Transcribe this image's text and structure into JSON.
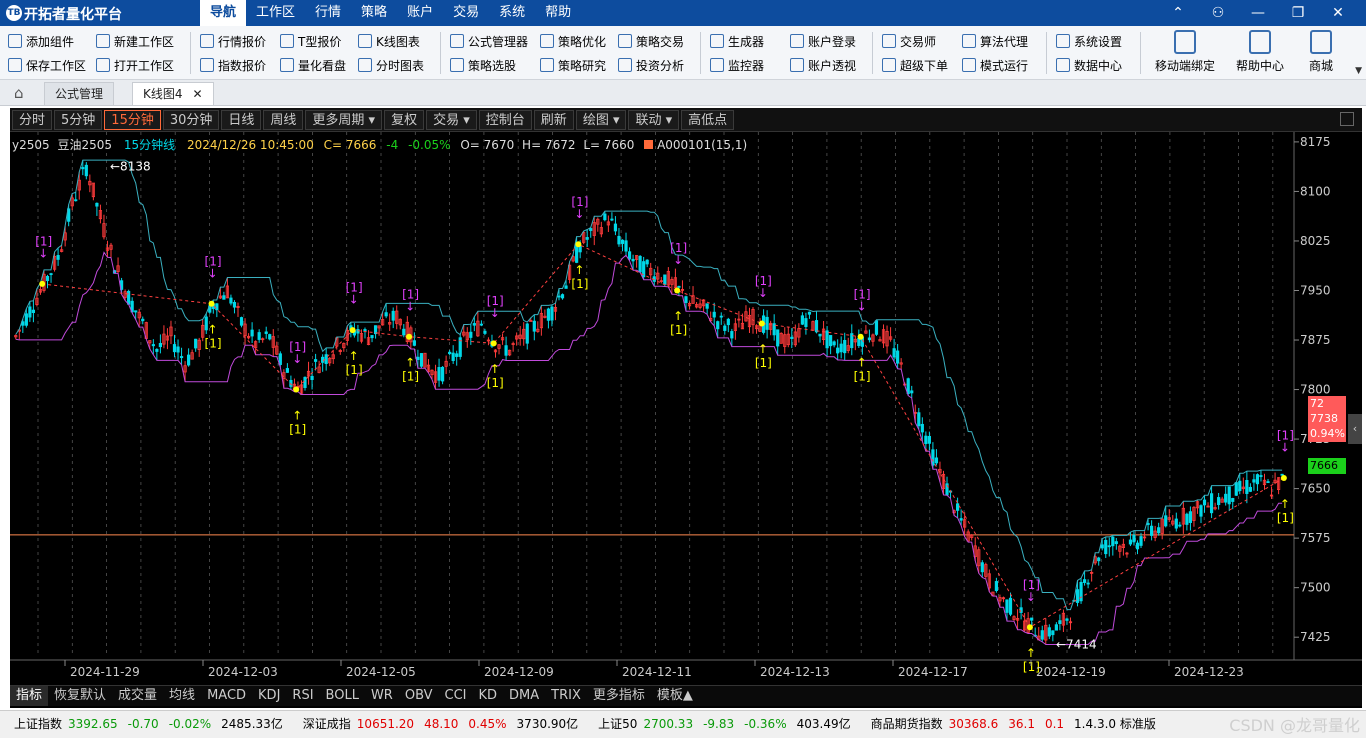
{
  "app": {
    "title": "开拓者量化平台",
    "logo_text": "TB"
  },
  "menu": [
    "导航",
    "工作区",
    "行情",
    "策略",
    "账户",
    "交易",
    "系统",
    "帮助"
  ],
  "menu_active": 0,
  "toolbar": {
    "col1": [
      "添加组件",
      "保存工作区"
    ],
    "col2": [
      "新建工作区",
      "打开工作区"
    ],
    "col3": [
      "行情报价",
      "指数报价"
    ],
    "col4": [
      "T型报价",
      "量化看盘"
    ],
    "col5": [
      "K线图表",
      "分时图表"
    ],
    "col6": [
      "公式管理器",
      "策略选股"
    ],
    "col7": [
      "策略优化",
      "策略研究"
    ],
    "col8": [
      "策略交易",
      "投资分析"
    ],
    "col9": [
      "生成器",
      "监控器"
    ],
    "col10": [
      "账户登录",
      "账户透视"
    ],
    "col11": [
      "交易师",
      "超级下单"
    ],
    "col12": [
      "算法代理",
      "模式运行"
    ],
    "col13": [
      "系统设置",
      "数据中心"
    ],
    "big": [
      "移动端绑定",
      "帮助中心",
      "商城"
    ]
  },
  "tabs": [
    "公式管理",
    "K线图4"
  ],
  "period_buttons": [
    "分时",
    "5分钟",
    "15分钟",
    "30分钟",
    "日线",
    "周线",
    "更多周期 ▾",
    "复权",
    "交易 ▾",
    "控制台",
    "刷新",
    "绘图 ▾",
    "联动 ▾",
    "高低点"
  ],
  "period_active": 2,
  "info": {
    "symbol": "y2505",
    "name": "豆油2505",
    "period": "15分钟线",
    "datetime": "2024/12/26 10:45:00",
    "close": "C= 7666",
    "change": "-4",
    "change_pct": "-0.05%",
    "open": "O= 7670",
    "high": "H= 7672",
    "low": "L= 7660",
    "indicator": "A000101(15,1)"
  },
  "chart_data": {
    "type": "candlestick",
    "y_ticks": [
      8175,
      8100,
      8025,
      7950,
      7875,
      7800,
      7725,
      7650,
      7575,
      7500,
      7425
    ],
    "ylim": [
      7395,
      8190
    ],
    "x_labels": [
      "2024-11-29",
      "2024-12-03",
      "2024-12-05",
      "2024-12-09",
      "2024-12-11",
      "2024-12-13",
      "2024-12-17",
      "2024-12-19",
      "2024-12-23"
    ],
    "max_label": "8138",
    "min_label": "7414",
    "reference_line": 7580,
    "price_box": {
      "line1": "72",
      "line2": "7738",
      "line3": "0.94%"
    },
    "last_price": "7666",
    "close_path": [
      7880,
      7920,
      7960,
      8000,
      8080,
      8138,
      8060,
      7990,
      7940,
      7900,
      7860,
      7880,
      7840,
      7870,
      7930,
      7950,
      7900,
      7870,
      7880,
      7830,
      7800,
      7830,
      7850,
      7870,
      7890,
      7880,
      7900,
      7910,
      7880,
      7840,
      7820,
      7850,
      7880,
      7900,
      7870,
      7860,
      7880,
      7900,
      7920,
      7960,
      8020,
      8040,
      8060,
      8020,
      7990,
      7980,
      7970,
      7950,
      7930,
      7920,
      7900,
      7890,
      7910,
      7900,
      7880,
      7870,
      7910,
      7890,
      7860,
      7870,
      7880,
      7890,
      7870,
      7820,
      7760,
      7700,
      7650,
      7600,
      7560,
      7510,
      7480,
      7460,
      7440,
      7430,
      7440,
      7470,
      7520,
      7560,
      7570,
      7560,
      7580,
      7590,
      7600,
      7610,
      7620,
      7630,
      7640,
      7650,
      7660,
      7650,
      7666
    ],
    "signals_sell": [
      "[1]",
      "[1]",
      "[1]",
      "[1]",
      "[1]",
      "[1]",
      "[1]",
      "[1]",
      "[1]",
      "[1]",
      "[1]",
      "[1]"
    ],
    "signals_buy": [
      "[1]",
      "[1]",
      "[1]",
      "[1]",
      "[1]",
      "[1]",
      "[1]",
      "[1]",
      "[1]",
      "[1]",
      "[1]"
    ]
  },
  "indicator_tabs": [
    "指标",
    "恢复默认",
    "成交量",
    "均线",
    "MACD",
    "KDJ",
    "RSI",
    "BOLL",
    "WR",
    "OBV",
    "CCI",
    "KD",
    "DMA",
    "TRIX",
    "更多指标",
    "模板▲"
  ],
  "indicator_active": 0,
  "status": {
    "items": [
      {
        "name": "上证指数",
        "value": "3392.65",
        "chg": "-0.70",
        "pct": "-0.02%",
        "amount": "2485.33亿"
      },
      {
        "name": "深证成指",
        "value": "10651.20",
        "chg": "48.10",
        "pct": "0.45%",
        "amount": "3730.90亿"
      },
      {
        "name": "上证50",
        "value": "2700.33",
        "chg": "-9.83",
        "pct": "-0.36%",
        "amount": "403.49亿"
      },
      {
        "name": "商品期货指数",
        "value": "30368.6",
        "chg": "36.1",
        "pct": "0.1",
        "amount": ""
      }
    ],
    "version": "1.4.3.0 标准版"
  },
  "watermark": "CSDN @龙哥量化",
  "colors": {
    "titlebar": "#0d4c9e",
    "up": "#ff3b3b",
    "down": "#00d8e8",
    "upper_band": "#3ab0c0",
    "lower_band": "#c04adb",
    "signal_yellow": "#ffff00",
    "signal_magenta": "#e040fb"
  }
}
